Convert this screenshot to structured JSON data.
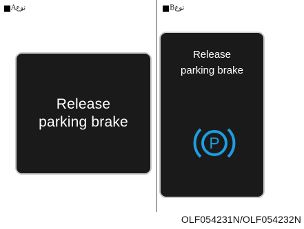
{
  "panels": [
    {
      "label_prefix": "نوع",
      "label_suffix": "A",
      "message_line1": "Release",
      "message_line2": "parking brake"
    },
    {
      "label_prefix": "نوع",
      "label_suffix": "B",
      "message_line1": "Release",
      "message_line2": "parking brake",
      "icon": "parking-brake-warning-icon",
      "icon_letter": "P",
      "icon_color": "#1e9ee0"
    }
  ],
  "image_code": "OLF054231N/OLF054232N",
  "colors": {
    "screen_bg": "#1a1a1a",
    "screen_border": "#c9c9c9"
  }
}
